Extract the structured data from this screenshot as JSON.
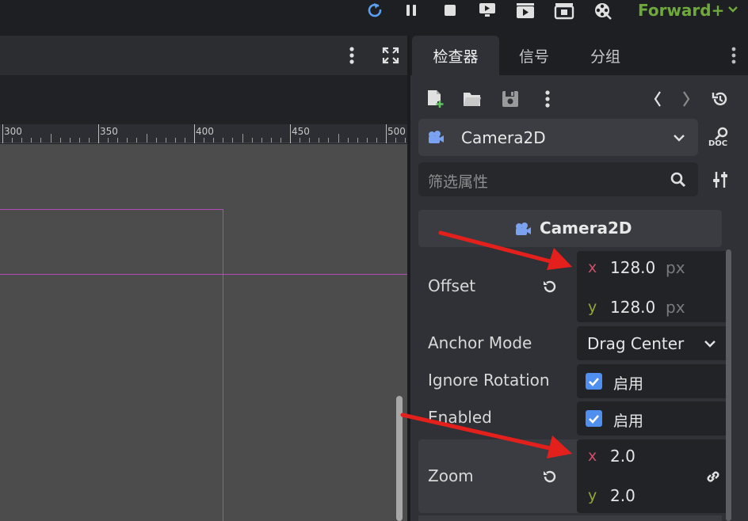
{
  "topbar": {
    "renderer": "Forward+",
    "icons": [
      "reload-icon",
      "pause-icon",
      "stop-icon",
      "remote-debug-icon",
      "play-scene-icon",
      "play-custom-icon",
      "movie-maker-icon",
      "renderer-dropdown"
    ]
  },
  "viewport": {
    "ruler": [
      "300",
      "350",
      "400",
      "450",
      "500"
    ]
  },
  "inspector": {
    "tabs": [
      "检查器",
      "信号",
      "分组"
    ],
    "class_name": "Camera2D",
    "doc_label": "DOC",
    "filter_placeholder": "筛选属性",
    "section_title": "Camera2D",
    "properties": {
      "offset": {
        "label": "Offset",
        "x": "128.0",
        "y": "128.0",
        "unit": "px"
      },
      "anchor_mode": {
        "label": "Anchor Mode",
        "value": "Drag Center"
      },
      "ignore_rotation": {
        "label": "Ignore Rotation",
        "checked": true,
        "text": "启用"
      },
      "enabled": {
        "label": "Enabled",
        "checked": true,
        "text": "启用"
      },
      "zoom": {
        "label": "Zoom",
        "x": "2.0",
        "y": "2.0"
      }
    },
    "axis_x": "x",
    "axis_y": "y"
  },
  "colors": {
    "accent_blue": "#4f8ff0",
    "renderer_green": "#6fa93b",
    "arrow_red": "#e3201c",
    "guide_magenta": "#b24bb7"
  }
}
